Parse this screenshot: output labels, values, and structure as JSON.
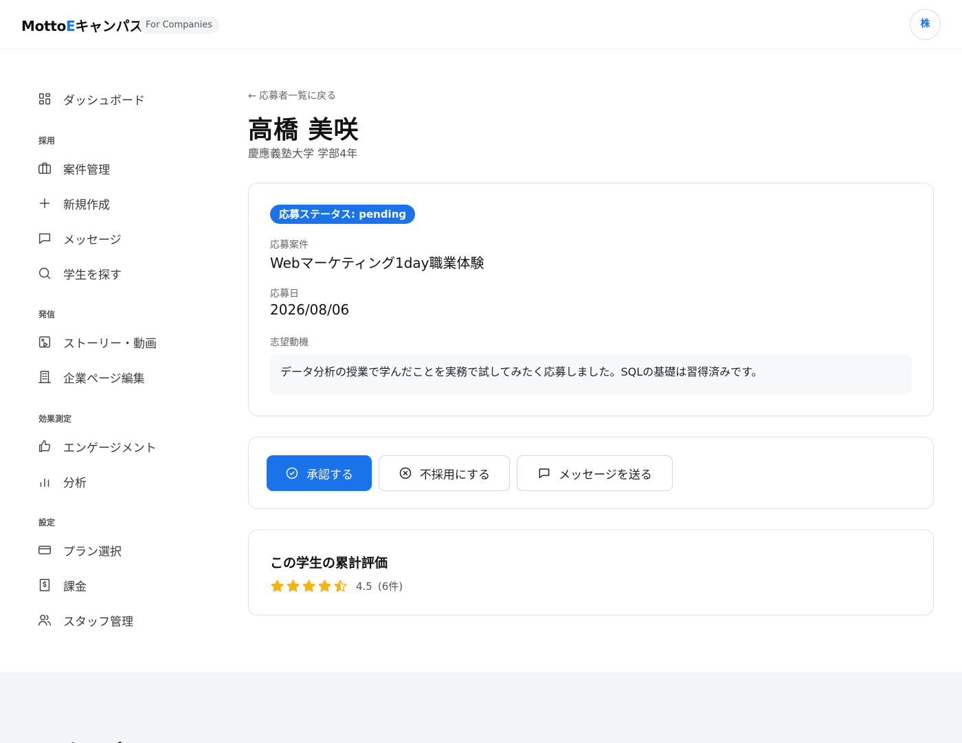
{
  "header": {
    "logo_prefix": "Motto",
    "logo_accent": "E",
    "logo_suffix": "キャンパス",
    "badge": "For Companies",
    "avatar_initial": "株"
  },
  "sidebar": {
    "dashboard": "ダッシュボード",
    "sections": {
      "recruit": "採用",
      "publish": "発信",
      "measure": "効果測定",
      "settings": "設定"
    },
    "items": {
      "jobs": "案件管理",
      "new": "新規作成",
      "messages": "メッセージ",
      "find_students": "学生を探す",
      "stories": "ストーリー・動画",
      "company_page": "企業ページ編集",
      "engagement": "エンゲージメント",
      "analytics": "分析",
      "plan": "プラン選択",
      "billing": "課金",
      "staff": "スタッフ管理"
    }
  },
  "main": {
    "back_link": "← 応募者一覧に戻る",
    "name": "高橋 美咲",
    "school": "慶應義塾大学 学部4年",
    "status_badge": "応募ステータス: pending",
    "job_label": "応募案件",
    "job_value": "Webマーケティング1day職業体験",
    "date_label": "応募日",
    "date_value": "2026/08/06",
    "motivation_label": "志望動機",
    "motivation_text": "データ分析の授業で学んだことを実務で試してみたく応募しました。SQLの基礎は習得済みです。",
    "actions": {
      "approve": "承認する",
      "reject": "不採用にする",
      "message": "メッセージを送る"
    },
    "rating": {
      "title": "この学生の累計評価",
      "value": "4.5",
      "count": "(6件)",
      "score": 4.5,
      "max": 5,
      "star_color": "#f5b316"
    }
  },
  "footer": {
    "logo": "Mottoキャンパス"
  },
  "colors": {
    "accent": "#1a73e8"
  }
}
